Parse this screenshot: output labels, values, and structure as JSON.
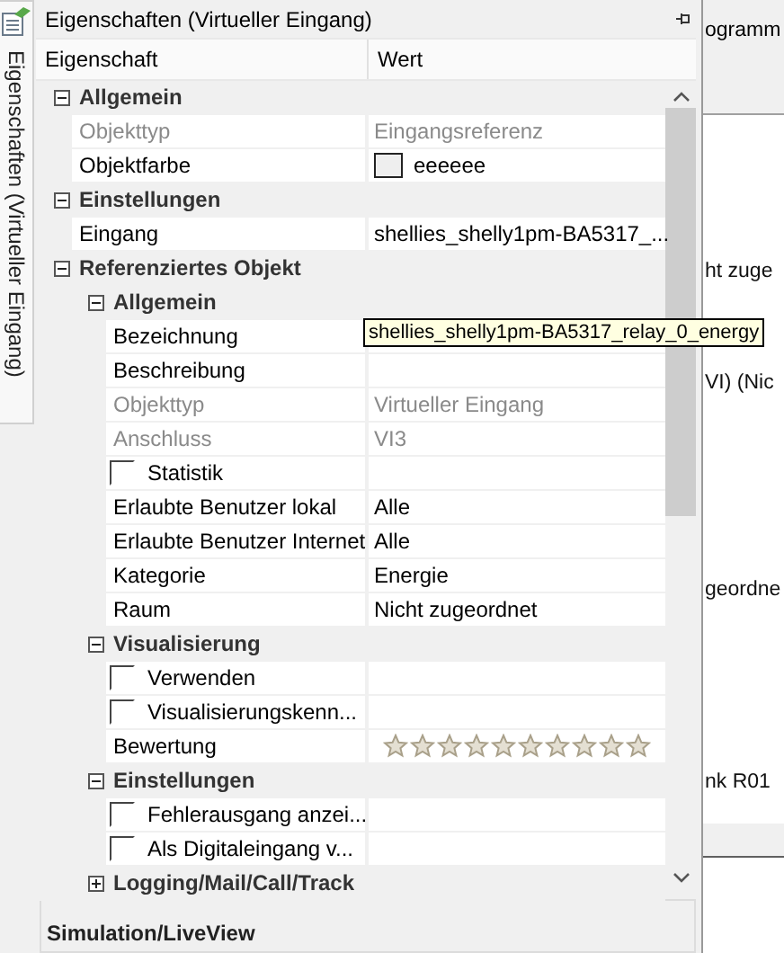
{
  "side_tab": {
    "label": "Eigenschaften (Virtueller Eingang)",
    "selected": true
  },
  "panel": {
    "title": "Eigenschaften (Virtueller Eingang)"
  },
  "grid": {
    "columns": [
      "Eigenschaft",
      "Wert"
    ],
    "rows": [
      {
        "kind": "category",
        "label": "Allgemein",
        "expanded": true,
        "children": [
          {
            "kind": "property",
            "name": "Objekttyp",
            "value": "Eingangsreferenz",
            "disabled": true
          },
          {
            "kind": "color",
            "name": "Objektfarbe",
            "value": "eeeeee",
            "color": "#eeeeee",
            "disabled": false
          }
        ]
      },
      {
        "kind": "category",
        "label": "Einstellungen",
        "expanded": true,
        "children": [
          {
            "kind": "property",
            "name": "Eingang",
            "value": "shellies_shelly1pm-BA5317_...",
            "disabled": false
          }
        ]
      },
      {
        "kind": "category",
        "label": "Referenziertes Objekt",
        "expanded": true,
        "children": [
          {
            "kind": "category",
            "label": "Allgemein",
            "expanded": true,
            "children": [
              {
                "kind": "property",
                "name": "Bezeichnung",
                "tooltip": "shellies_shelly1pm-BA5317_relay_0_energy",
                "disabled": false
              },
              {
                "kind": "property",
                "name": "Beschreibung",
                "disabled": false
              },
              {
                "kind": "property",
                "name": "Objekttyp",
                "value": "Virtueller Eingang",
                "disabled": true
              },
              {
                "kind": "property",
                "name": "Anschluss",
                "value": "VI3",
                "disabled": true
              },
              {
                "kind": "checkbox",
                "name": "Statistik",
                "checked": false
              },
              {
                "kind": "property",
                "name": "Erlaubte Benutzer lokal",
                "value": "Alle",
                "disabled": false
              },
              {
                "kind": "property",
                "name": "Erlaubte Benutzer Internet",
                "value": "Alle",
                "disabled": false
              },
              {
                "kind": "property",
                "name": "Kategorie",
                "value": "Energie",
                "disabled": false
              },
              {
                "kind": "property",
                "name": "Raum",
                "value": "Nicht zugeordnet",
                "disabled": false
              }
            ]
          },
          {
            "kind": "category",
            "label": "Visualisierung",
            "expanded": true,
            "children": [
              {
                "kind": "checkbox",
                "name": "Verwenden",
                "checked": false
              },
              {
                "kind": "checkbox",
                "name": "Visualisierungskenn...",
                "checked": false
              },
              {
                "kind": "rating",
                "name": "Bewertung",
                "stars": 0
              }
            ]
          },
          {
            "kind": "category",
            "label": "Einstellungen",
            "expanded": true,
            "children": [
              {
                "kind": "checkbox",
                "name": "Fehlerausgang anzei...",
                "checked": false
              },
              {
                "kind": "checkbox",
                "name": "Als Digitaleingang v...",
                "checked": false
              }
            ]
          },
          {
            "kind": "category",
            "label": "Logging/Mail/Call/Track",
            "expanded": false
          }
        ]
      }
    ]
  },
  "bottom_panel": {
    "title": "Simulation/LiveView"
  },
  "background": {
    "texts": [
      "ogramm",
      "ht zuge",
      "VI) (Nic",
      "geordne",
      "nk R01"
    ]
  }
}
